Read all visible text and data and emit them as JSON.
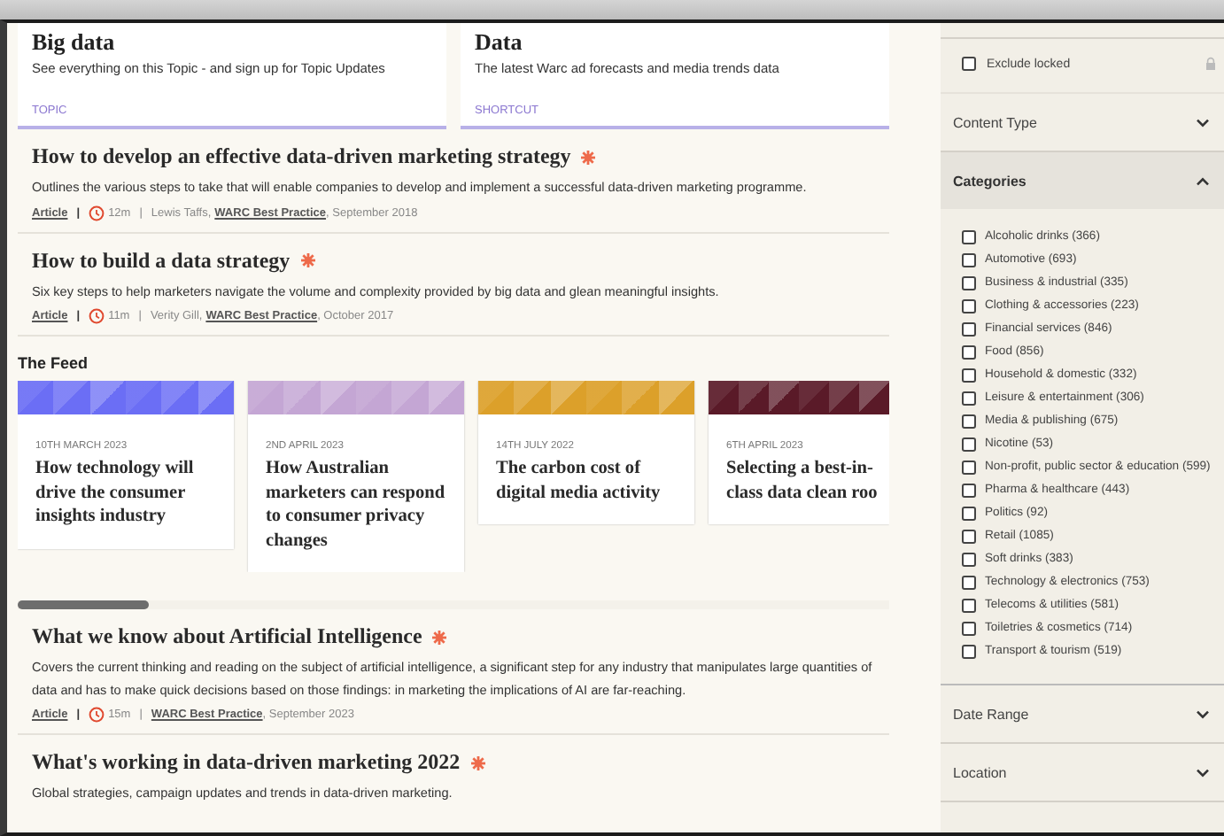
{
  "topic_cards": [
    {
      "title": "Big data",
      "description": "See everything on this Topic - and sign up for Topic Updates",
      "tag": "TOPIC"
    },
    {
      "title": "Data",
      "description": "The latest Warc ad forecasts and media trends data",
      "tag": "SHORTCUT"
    }
  ],
  "articles_top": [
    {
      "title": "How to develop an effective data-driven marketing strategy",
      "description": "Outlines the various steps to take that will enable companies to develop and implement a successful data-driven marketing programme.",
      "type": "Article",
      "separator": "|",
      "duration": "12m",
      "separator_2": "|",
      "author": "Lewis Taffs,",
      "source": "WARC Best Practice",
      "date": ", September 2018"
    },
    {
      "title": "How to build a data strategy",
      "description": "Six key steps to help marketers navigate the volume and complexity provided by big data and glean meaningful insights.",
      "type": "Article",
      "separator": "|",
      "duration": "11m",
      "separator_2": "|",
      "author": "Verity Gill,",
      "source": "WARC Best Practice",
      "date": ", October 2017"
    }
  ],
  "feed": {
    "title": "The Feed",
    "cards": [
      {
        "date": "10TH MARCH 2023",
        "title": "How technology will drive the consumer insights industry",
        "color": "#6b6ef5"
      },
      {
        "date": "2ND APRIL 2023",
        "title": "How Australian marketers can respond to consumer privacy changes",
        "color": "#c4a6d4"
      },
      {
        "date": "14TH JULY 2022",
        "title": "The carbon cost of digital media activity",
        "color": "#dca02a"
      },
      {
        "date": "6TH APRIL 2023",
        "title": "Selecting a best-in-class data clean roo",
        "color": "#5a1a28"
      }
    ]
  },
  "articles_bottom": [
    {
      "title": "What we know about Artificial Intelligence",
      "description": "Covers the current thinking and reading on the subject of artificial intelligence, a significant step for any industry that manipulates large quantities of data and has to make quick decisions based on those findings: in marketing the implications of AI are far-reaching.",
      "type": "Article",
      "separator": "|",
      "duration": "15m",
      "separator_2": "|",
      "source": "WARC Best Practice",
      "date": ", September 2023"
    },
    {
      "title": "What's working in data-driven marketing 2022",
      "description": "Global strategies, campaign updates and trends in data-driven marketing."
    }
  ],
  "sidebar": {
    "exclude_locked": {
      "label": "Exclude locked",
      "checked": false
    },
    "sections": [
      {
        "title": "Content Type",
        "expanded": false
      },
      {
        "title": "Categories",
        "expanded": true,
        "options": [
          {
            "label": "Alcoholic drinks (366)",
            "checked": false
          },
          {
            "label": "Automotive (693)",
            "checked": false
          },
          {
            "label": "Business & industrial (335)",
            "checked": false
          },
          {
            "label": "Clothing & accessories (223)",
            "checked": false
          },
          {
            "label": "Financial services (846)",
            "checked": false
          },
          {
            "label": "Food (856)",
            "checked": false
          },
          {
            "label": "Household & domestic (332)",
            "checked": false
          },
          {
            "label": "Leisure & entertainment (306)",
            "checked": false
          },
          {
            "label": "Media & publishing (675)",
            "checked": false
          },
          {
            "label": "Nicotine (53)",
            "checked": false
          },
          {
            "label": "Non-profit, public sector & education (599)",
            "checked": false
          },
          {
            "label": "Pharma & healthcare (443)",
            "checked": false
          },
          {
            "label": "Politics (92)",
            "checked": false
          },
          {
            "label": "Retail (1085)",
            "checked": false
          },
          {
            "label": "Soft drinks (383)",
            "checked": false
          },
          {
            "label": "Technology & electronics (753)",
            "checked": false
          },
          {
            "label": "Telecoms & utilities (581)",
            "checked": false
          },
          {
            "label": "Toiletries & cosmetics (714)",
            "checked": false
          },
          {
            "label": "Transport & tourism (519)",
            "checked": false
          }
        ]
      },
      {
        "title": "Date Range",
        "expanded": false
      },
      {
        "title": "Location",
        "expanded": false
      }
    ]
  }
}
